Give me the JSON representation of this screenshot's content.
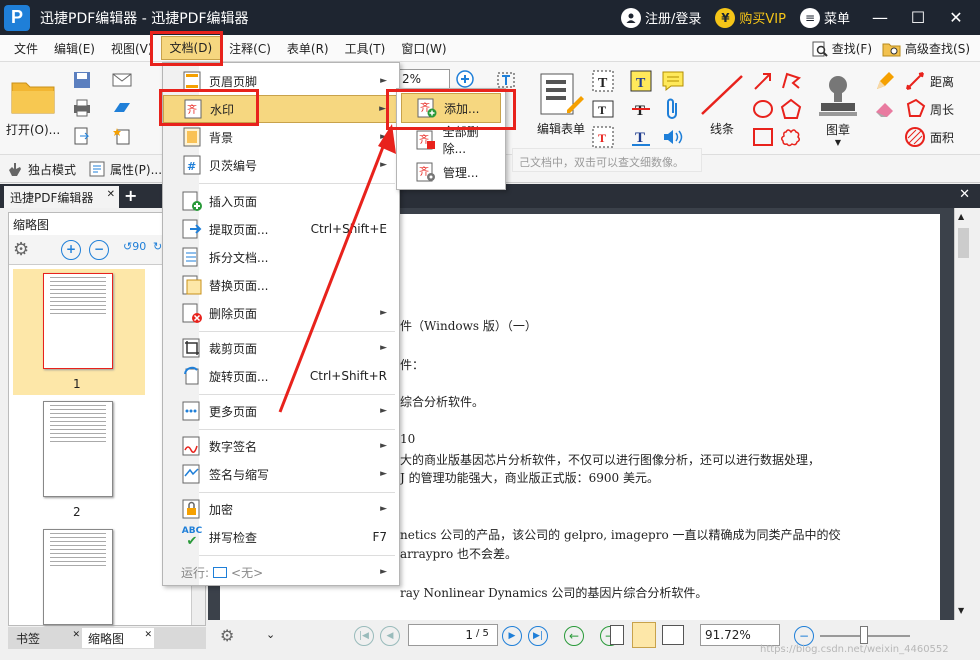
{
  "app": {
    "logo_letter": "P",
    "title": "迅捷PDF编辑器 - 迅捷PDF编辑器",
    "login": "注册/登录",
    "vip": "购买VIP",
    "vip_symbol": "¥",
    "menu": "菜单",
    "min": "—",
    "max": "☐",
    "close": "✕"
  },
  "menubar": {
    "items": [
      "文件",
      "编辑(E)",
      "视图(V)",
      "文档(D)",
      "注释(C)",
      "表单(R)",
      "工具(T)",
      "窗口(W)"
    ],
    "find": "查找(F)",
    "adv_find": "高级查找(S)"
  },
  "ribbon": {
    "open": "打开(O)...",
    "edit_form": "编辑表单",
    "zoom_value": "2%",
    "line": "线条",
    "stamp": "图章",
    "distance": "距离",
    "perimeter": "周长",
    "area": "面积"
  },
  "toolbar2": {
    "exclusive": "独占模式",
    "properties": "属性(P)..."
  },
  "doc_tab": {
    "label": "迅捷PDF编辑器",
    "add": "+",
    "close": "✕"
  },
  "left_panel": {
    "title": "缩略图",
    "pages": [
      "1",
      "2"
    ]
  },
  "bottom_tabs": {
    "bookmarks": "书签",
    "thumbnails": "缩略图",
    "close": "✕"
  },
  "document": {
    "lines": [
      "件（Windows 版）（一）",
      "件：",
      "综合分析软件。",
      "10",
      "大的商业版基因芯片分析软件，不仅可以进行图像分析，还可以进行数据处理，",
      "J 的管理功能强大，商业版正式版：6900 美元。",
      "netics 公司的产品，该公司的 gelpro, imagepro 一直以精确成为同类产品中的佼",
      "arraypro 也不会差。",
      "ray Nonlinear Dynamics 公司的基因片综合分析软件。"
    ]
  },
  "hint": "己文档中，双击可以查文细数像。",
  "statusbar": {
    "page_input": "1",
    "page_total": "/ 5",
    "zoom": "91.72%",
    "watermark": "https://blog.csdn.net/weixin_4460552"
  },
  "dropdown": {
    "items": [
      {
        "label": "页眉页脚",
        "shortcut": "",
        "arrow": "►"
      },
      {
        "label": "水印",
        "shortcut": "",
        "arrow": "►"
      },
      {
        "label": "背景",
        "shortcut": "",
        "arrow": "►"
      },
      {
        "label": "贝茨编号",
        "shortcut": "",
        "arrow": "►"
      },
      {
        "label": "插入页面",
        "shortcut": "",
        "arrow": ""
      },
      {
        "label": "提取页面...",
        "shortcut": "Ctrl+Shift+E",
        "arrow": ""
      },
      {
        "label": "拆分文档...",
        "shortcut": "",
        "arrow": ""
      },
      {
        "label": "替换页面...",
        "shortcut": "",
        "arrow": ""
      },
      {
        "label": "删除页面",
        "shortcut": "",
        "arrow": "►"
      },
      {
        "label": "裁剪页面",
        "shortcut": "",
        "arrow": "►"
      },
      {
        "label": "旋转页面...",
        "shortcut": "Ctrl+Shift+R",
        "arrow": ""
      },
      {
        "label": "更多页面",
        "shortcut": "",
        "arrow": "►"
      },
      {
        "label": "数字签名",
        "shortcut": "",
        "arrow": "►"
      },
      {
        "label": "签名与缩写",
        "shortcut": "",
        "arrow": "►"
      },
      {
        "label": "加密",
        "shortcut": "",
        "arrow": "►"
      },
      {
        "label": "拼写检查",
        "shortcut": "F7",
        "arrow": ""
      },
      {
        "label": "运行:",
        "shortcut": "",
        "arrow": "►",
        "extra": "<无>"
      }
    ]
  },
  "submenu": {
    "items": [
      "添加...",
      "全部删除...",
      "管理..."
    ]
  },
  "colors": {
    "titlebar": "#1e2530",
    "highlight": "#f6d780",
    "red_annotation": "#e8221c",
    "accent": "#1f7fd8"
  }
}
